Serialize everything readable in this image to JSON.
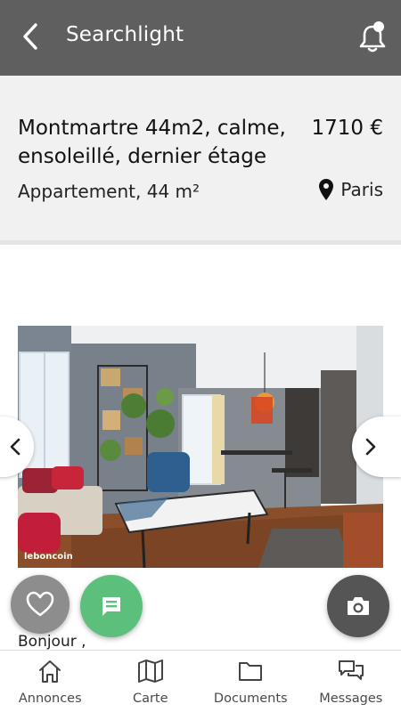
{
  "header": {
    "title": "Searchlight",
    "back_icon": "chevron-left-icon",
    "notification_icon": "bell-icon"
  },
  "listing": {
    "title": "Montmartre 44m2, calme, ensoleillé, dernier étage",
    "price": "1710 €",
    "type": "Appartement, 44 m²",
    "location": "Paris"
  },
  "photo": {
    "watermark": "leboncoin"
  },
  "description_preview": "Bonjour ,",
  "actions": {
    "favorite_icon": "heart-icon",
    "message_icon": "chat-icon",
    "camera_icon": "camera-icon"
  },
  "bottom_nav": [
    {
      "label": "Annonces",
      "icon": "home-icon"
    },
    {
      "label": "Carte",
      "icon": "map-icon"
    },
    {
      "label": "Documents",
      "icon": "folder-icon"
    },
    {
      "label": "Messages",
      "icon": "messages-icon"
    }
  ],
  "colors": {
    "header": "#5f5f5f",
    "accent_green": "#5cc07c",
    "panel": "#f1f1f1"
  }
}
